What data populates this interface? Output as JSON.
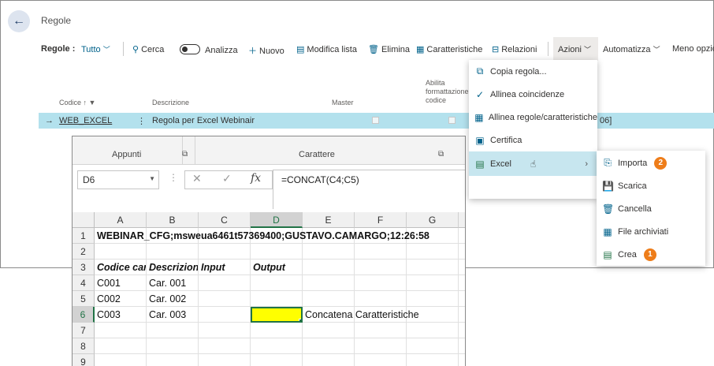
{
  "page": {
    "title": "Regole"
  },
  "actionbar": {
    "filter_label": "Regole :",
    "filter_value": "Tutto",
    "search": "Cerca",
    "analyze": "Analizza",
    "new": "Nuovo",
    "edit_list": "Modifica lista",
    "delete": "Elimina",
    "characteristics": "Caratteristiche",
    "relations": "Relazioni",
    "actions": "Azioni",
    "automate": "Automatizza",
    "fewer_options": "Meno opzioni"
  },
  "grid": {
    "columns": {
      "code": "Codice",
      "description": "Descrizione",
      "master": "Master",
      "enable_format": "Abilita formattazione codice"
    },
    "row": {
      "code": "WEB_EXCEL",
      "description": "Regola per Excel Webinair",
      "trailing": "06]"
    }
  },
  "menu_azioni": {
    "items": [
      {
        "label": "Copia regola...",
        "icon": "copy-icon"
      },
      {
        "label": "Allinea coincidenze",
        "icon": "check-icon"
      },
      {
        "label": "Allinea regole/caratteristiche",
        "icon": "table-icon"
      },
      {
        "label": "Certifica",
        "icon": "certificate-icon"
      },
      {
        "label": "Excel",
        "icon": "excel-icon"
      }
    ]
  },
  "menu_excel": {
    "items": [
      {
        "label": "Importa",
        "icon": "import-icon",
        "badge": "2"
      },
      {
        "label": "Scarica",
        "icon": "save-icon",
        "badge": ""
      },
      {
        "label": "Cancella",
        "icon": "trash-icon",
        "badge": ""
      },
      {
        "label": "File archiviati",
        "icon": "archive-icon",
        "badge": ""
      },
      {
        "label": "Crea",
        "icon": "excel-icon",
        "badge": "1"
      }
    ]
  },
  "excel": {
    "ribbon": {
      "clipboard": "Appunti",
      "font": "Carattere"
    },
    "name_box": "D6",
    "formula": "=CONCAT(C4;C5)",
    "columns": [
      "A",
      "B",
      "C",
      "D",
      "E",
      "F",
      "G"
    ],
    "rows": [
      "1",
      "2",
      "3",
      "4",
      "5",
      "6",
      "7",
      "8",
      "9"
    ],
    "cells": {
      "A1": "WEBINAR_CFG;msweua6461t57369400;GUSTAVO.CAMARGO;12:26:58",
      "A3": "Codice car",
      "B3": "Descrizion",
      "C3": "Input",
      "D3": "Output",
      "A4": "C001",
      "B4": "Car. 001",
      "A5": "C002",
      "B5": "Car. 002",
      "A6": "C003",
      "B6": "Car. 003",
      "E6": "Concatena Caratteristiche"
    },
    "selected_cell_color": "#ffff00"
  },
  "colors": {
    "accent": "#00628b",
    "row_highlight": "#b3e1ed",
    "badge": "#ee7d1a",
    "excel_green": "#217346"
  }
}
